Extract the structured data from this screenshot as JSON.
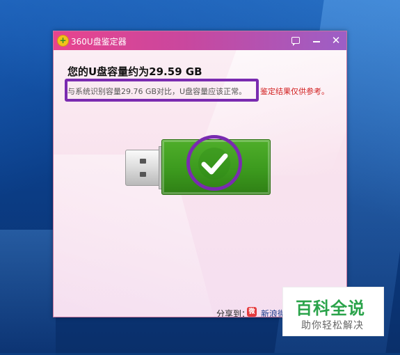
{
  "window": {
    "title": "360U盘鉴定器"
  },
  "result": {
    "headline": "您的U盘容量约为29.59 GB",
    "note": "与系统识别容量29.76 GB对比，U盘容量应该正常。",
    "warning": "鉴定结果仅供参考。"
  },
  "share": {
    "label": "分享到：",
    "weibo_label": "新浪微"
  },
  "icons": {
    "app_logo": "360-logo-icon",
    "message": "message-icon",
    "minimize": "minimize-icon",
    "close": "close-icon",
    "usb": "usb-drive-icon",
    "check": "check-icon",
    "weibo": "weibo-icon"
  },
  "colors": {
    "titlebar_start": "#e8448e",
    "titlebar_end": "#9c5fc6",
    "usb_green": "#3c9a1e",
    "highlight_purple": "#7a2bb0",
    "warning_red": "#d21f1f",
    "watermark_green": "#2aa34a"
  },
  "watermark": {
    "title": "百科全说",
    "subtitle": "助你轻松解决"
  }
}
